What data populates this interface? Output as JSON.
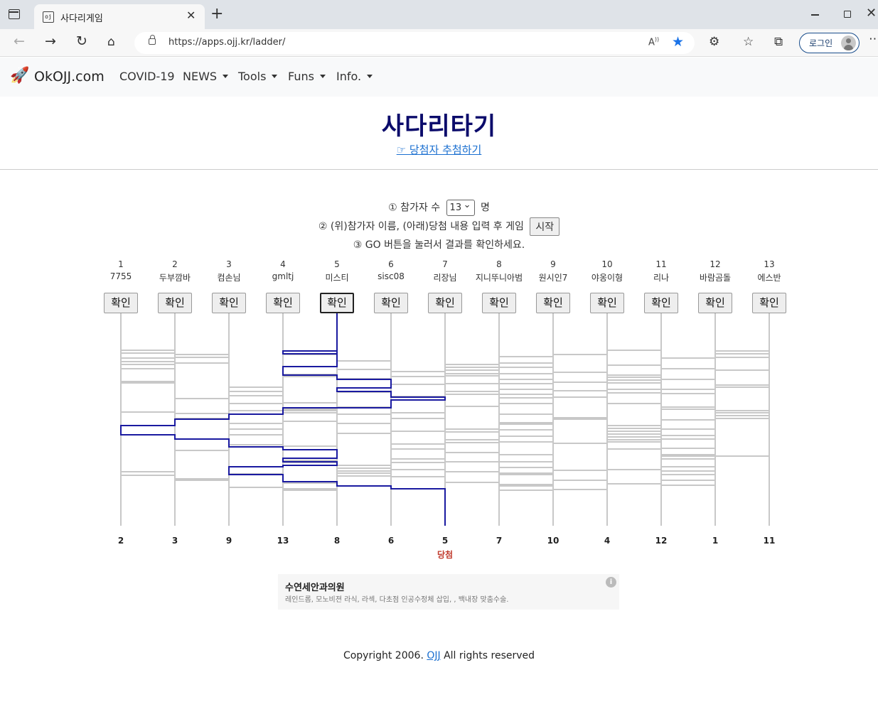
{
  "browser": {
    "tab_title": "사다리게임",
    "tab_favicon": "ojj-favicon",
    "url": "https://apps.ojj.kr/ladder/",
    "profile_label": "로그인",
    "icons": [
      "tab-actions-icon",
      "back-icon",
      "forward-icon",
      "refresh-icon",
      "home-icon",
      "lock-icon",
      "read-aloud-icon",
      "favorite-star-icon",
      "extensions-icon",
      "favorites-icon",
      "collections-icon",
      "more-icon"
    ]
  },
  "navbar": {
    "brand": "OkOJJ.com",
    "items": [
      {
        "label": "COVID-19",
        "dropdown": false
      },
      {
        "label": "NEWS",
        "dropdown": true
      },
      {
        "label": "Tools",
        "dropdown": true
      },
      {
        "label": "Funs",
        "dropdown": true
      },
      {
        "label": "Info.",
        "dropdown": true
      }
    ]
  },
  "header": {
    "title": "사다리타기",
    "link": "☞ 당첨자 추첨하기"
  },
  "instructions": {
    "step1_prefix": "① 참가자 수",
    "count": "13",
    "step1_suffix": "명",
    "step2": "② (위)참가자 이름, (아래)당첨 내용 입력 후 게임",
    "start_label": "시작",
    "step3": "③ GO 버튼을 눌러서 결과를 확인하세요."
  },
  "ladder": {
    "check_label": "확인",
    "active_player": 5,
    "players": [
      {
        "num": "1",
        "name": "7755"
      },
      {
        "num": "2",
        "name": "두부깜바"
      },
      {
        "num": "3",
        "name": "컴손님"
      },
      {
        "num": "4",
        "name": "gmltj"
      },
      {
        "num": "5",
        "name": "미스티"
      },
      {
        "num": "6",
        "name": "sisc08"
      },
      {
        "num": "7",
        "name": "리장님"
      },
      {
        "num": "8",
        "name": "지니뚜니아범"
      },
      {
        "num": "9",
        "name": "원시인7"
      },
      {
        "num": "10",
        "name": "야옹이형"
      },
      {
        "num": "11",
        "name": "리나"
      },
      {
        "num": "12",
        "name": "바람곰돌"
      },
      {
        "num": "13",
        "name": "에스반"
      }
    ],
    "results": [
      "2",
      "3",
      "9",
      "13",
      "8",
      "6",
      "5",
      "7",
      "10",
      "4",
      "12",
      "1",
      "11"
    ],
    "win_label": "당첨",
    "win_index": 6,
    "line_color": "#c8c8c8",
    "path_color": "#1a1aa0"
  },
  "ad": {
    "title": "수연세안과의원",
    "desc": "레인드롭, 모노비젼 라식, 라섹, 다초점 인공수정체 삽입, , 백내장 맞춤수술.",
    "info_icon": "i"
  },
  "footer": {
    "prefix": "Copyright 2006.",
    "link": "OJJ",
    "suffix": "All rights reserved"
  }
}
